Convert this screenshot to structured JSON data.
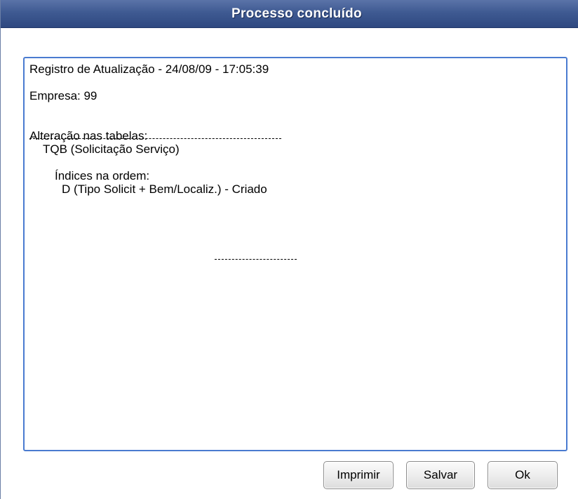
{
  "window": {
    "title": "Processo concluído"
  },
  "log": {
    "header": "Registro de Atualização - 24/08/09 - 17:05:39",
    "company": "Empresa: 99",
    "tables_heading": "Alteração nas tabelas:",
    "table_name": "TQB (Solicitação Serviço)",
    "indexes_heading": "Índices na ordem:",
    "index_entry": "D (Tipo Solicit + Bem/Localiz.) - Criado"
  },
  "buttons": {
    "print_label": "Imprimir",
    "save_label": "Salvar",
    "ok_label": "Ok"
  },
  "colors": {
    "titlebar": "#3f5a92",
    "log_border": "#4a7bd0"
  }
}
